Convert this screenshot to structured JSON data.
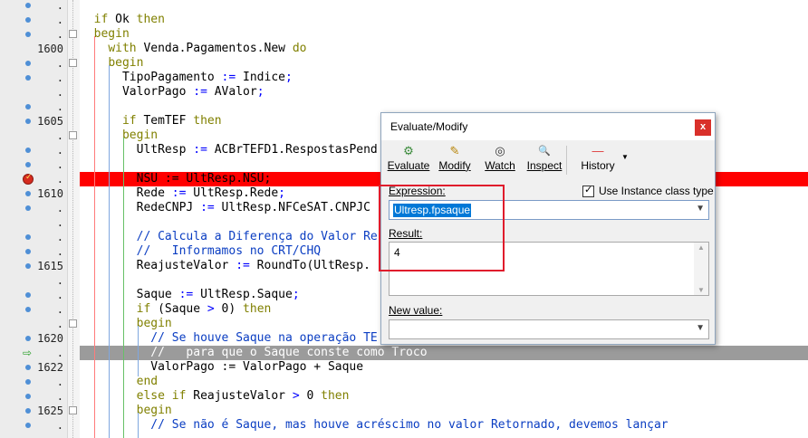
{
  "gutter": {
    "markers": [
      "dot",
      "dot",
      "dot",
      "none",
      "dot",
      "dot",
      "none",
      "dot",
      "dot",
      "none",
      "dot",
      "dot",
      "bp",
      "dot",
      "dot",
      "none",
      "dot",
      "dot",
      "dot",
      "none",
      "dot",
      "dot",
      "none",
      "dot",
      "exec",
      "dot",
      "dot",
      "dot",
      "dot",
      "dot"
    ],
    "line_numbers": [
      "",
      "",
      "",
      "1600",
      "",
      "",
      "",
      "",
      "1605",
      "",
      "",
      "",
      "",
      "1610",
      "",
      "",
      "",
      "",
      "1615",
      "",
      "",
      "",
      "",
      "1620",
      "",
      "1622",
      "",
      "",
      "1625",
      ""
    ],
    "dot_suffix": "."
  },
  "code": {
    "lines": [
      {
        "indent": "",
        "parts": [
          [
            "",
            ""
          ]
        ]
      },
      {
        "indent": "",
        "parts": [
          [
            "kw",
            "if"
          ],
          [
            "",
            " Ok "
          ],
          [
            "kw",
            "then"
          ]
        ]
      },
      {
        "indent": "",
        "parts": [
          [
            "kw",
            "begin"
          ]
        ]
      },
      {
        "indent": "  ",
        "parts": [
          [
            "kw",
            "with"
          ],
          [
            "",
            " Venda.Pagamentos.New "
          ],
          [
            "kw",
            "do"
          ]
        ]
      },
      {
        "indent": "  ",
        "parts": [
          [
            "kw",
            "begin"
          ]
        ]
      },
      {
        "indent": "    ",
        "parts": [
          [
            "",
            "TipoPagamento "
          ],
          [
            "op",
            ":="
          ],
          [
            "",
            " Indice"
          ],
          [
            "op",
            ";"
          ]
        ]
      },
      {
        "indent": "    ",
        "parts": [
          [
            "",
            "ValorPago "
          ],
          [
            "op",
            ":="
          ],
          [
            "",
            " AValor"
          ],
          [
            "op",
            ";"
          ]
        ]
      },
      {
        "indent": "",
        "parts": [
          [
            "",
            ""
          ]
        ]
      },
      {
        "indent": "    ",
        "parts": [
          [
            "kw",
            "if"
          ],
          [
            "",
            " TemTEF "
          ],
          [
            "kw",
            "then"
          ]
        ]
      },
      {
        "indent": "    ",
        "parts": [
          [
            "kw",
            "begin"
          ]
        ]
      },
      {
        "indent": "      ",
        "parts": [
          [
            "",
            "UltResp "
          ],
          [
            "op",
            ":="
          ],
          [
            "",
            " ACBrTEFD1.RespostasPend"
          ]
        ]
      },
      {
        "indent": "",
        "parts": [
          [
            "",
            ""
          ]
        ]
      },
      {
        "indent": "      ",
        "parts": [
          [
            "",
            "NSU := UltResp.NSU;"
          ]
        ]
      },
      {
        "indent": "      ",
        "parts": [
          [
            "",
            "Rede "
          ],
          [
            "op",
            ":="
          ],
          [
            "",
            " UltResp.Rede"
          ],
          [
            "op",
            ";"
          ]
        ]
      },
      {
        "indent": "      ",
        "parts": [
          [
            "",
            "RedeCNPJ "
          ],
          [
            "op",
            ":="
          ],
          [
            "",
            " UltResp.NFCeSAT.CNPJC"
          ]
        ]
      },
      {
        "indent": "",
        "parts": [
          [
            "",
            ""
          ]
        ]
      },
      {
        "indent": "      ",
        "parts": [
          [
            "cm",
            "// Calcula a Diferença do Valor Re"
          ]
        ]
      },
      {
        "indent": "      ",
        "parts": [
          [
            "cm",
            "//   Informamos no CRT/CHQ"
          ]
        ]
      },
      {
        "indent": "      ",
        "parts": [
          [
            "",
            "ReajusteValor "
          ],
          [
            "op",
            ":="
          ],
          [
            "",
            " RoundTo(UltResp."
          ]
        ]
      },
      {
        "indent": "",
        "parts": [
          [
            "",
            ""
          ]
        ]
      },
      {
        "indent": "      ",
        "parts": [
          [
            "",
            "Saque "
          ],
          [
            "op",
            ":="
          ],
          [
            "",
            " UltResp.Saque"
          ],
          [
            "op",
            ";"
          ]
        ]
      },
      {
        "indent": "      ",
        "parts": [
          [
            "kw",
            "if"
          ],
          [
            "",
            " (Saque "
          ],
          [
            "op",
            ">"
          ],
          [
            "",
            " 0) "
          ],
          [
            "kw",
            "then"
          ]
        ]
      },
      {
        "indent": "      ",
        "parts": [
          [
            "kw",
            "begin"
          ]
        ]
      },
      {
        "indent": "        ",
        "parts": [
          [
            "cm",
            "// Se houve Saque na operação TE"
          ]
        ]
      },
      {
        "indent": "        ",
        "parts": [
          [
            "cm",
            "//   para que o Saque conste como Troco"
          ]
        ]
      },
      {
        "indent": "        ",
        "parts": [
          [
            "",
            "ValorPago := ValorPago + Saque"
          ]
        ]
      },
      {
        "indent": "      ",
        "parts": [
          [
            "kw",
            "end"
          ]
        ]
      },
      {
        "indent": "      ",
        "parts": [
          [
            "kw",
            "else if"
          ],
          [
            "",
            " ReajusteValor "
          ],
          [
            "op",
            ">"
          ],
          [
            "",
            " 0 "
          ],
          [
            "kw",
            "then"
          ]
        ]
      },
      {
        "indent": "      ",
        "parts": [
          [
            "kw",
            "begin"
          ]
        ]
      },
      {
        "indent": "        ",
        "parts": [
          [
            "cm",
            "// Se não é Saque, mas houve acréscimo no valor Retornado, devemos lançar"
          ]
        ]
      }
    ]
  },
  "dialog": {
    "title": "Evaluate/Modify",
    "close_label": "x",
    "toolbar": [
      {
        "id": "evaluate",
        "label": "Evaluate",
        "icon": "⚙"
      },
      {
        "id": "modify",
        "label": "Modify",
        "icon": "✎"
      },
      {
        "id": "watch",
        "label": "Watch",
        "icon": "◎"
      },
      {
        "id": "inspect",
        "label": "Inspect",
        "icon": "🔍"
      },
      {
        "id": "history",
        "label": "History",
        "icon": "—"
      }
    ],
    "expression_label": "Expression:",
    "expression_value": "Ultresp.fpsaque",
    "use_instance_label": "Use Instance class type",
    "use_instance_checked": true,
    "result_label": "Result:",
    "result_value": "4",
    "new_value_label": "New value:",
    "new_value": ""
  },
  "colors": {
    "breakpoint_line": "#ff0000",
    "exec_line": "#9b9b9b",
    "keyword": "#808000",
    "comment": "#0a3dc2",
    "highlight_box": "#e01c2c"
  }
}
